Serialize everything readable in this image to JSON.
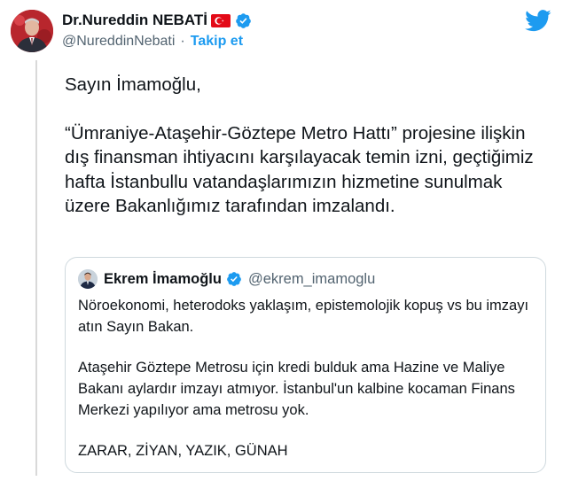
{
  "author": {
    "display_name": "Dr.Nureddin NEBATİ",
    "handle": "@NureddinNebati",
    "separator": "·",
    "follow_label": "Takip et"
  },
  "tweet": {
    "greeting": "Sayın İmamoğlu,",
    "body": "“Ümraniye-Ataşehir-Göztepe Metro Hattı” projesine ilişkin dış finansman ihtiyacını karşılayacak temin izni, geçtiğimiz hafta İstanbullu vatandaşlarımızın hizmetine sunulmak üzere Bakanlığımız tarafından imzalandı."
  },
  "quoted": {
    "display_name": "Ekrem İmamoğlu",
    "handle": "@ekrem_imamoglu",
    "paragraphs": [
      "Nöroekonomi, heterodoks yaklaşım, epistemolojik kopuş vs bu imzayı atın Sayın Bakan.",
      "Ataşehir Göztepe Metrosu için kredi bulduk ama Hazine ve Maliye Bakanı aylardır imzayı atmıyor. İstanbul'un kalbine kocaman Finans Merkezi yapılıyor ama metrosu yok.",
      "ZARAR, ZİYAN, YAZIK, GÜNAH"
    ]
  },
  "icons": {
    "verified": "verified-badge-icon",
    "flag": "turkey-flag-icon",
    "logo": "twitter-bird-icon"
  },
  "colors": {
    "accent": "#1d9bf0",
    "text": "#0f1419",
    "secondary": "#536471",
    "border": "#cfd9de",
    "flag_red": "#e30a17"
  }
}
